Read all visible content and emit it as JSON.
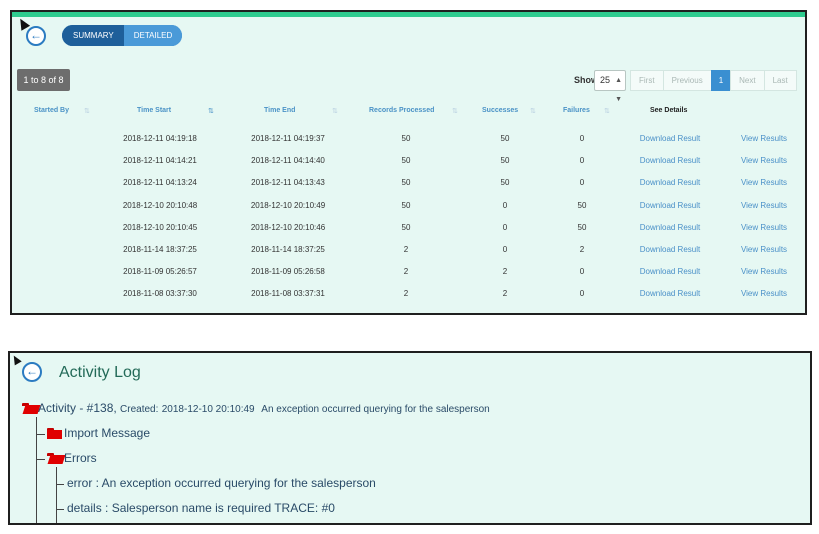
{
  "summary_panel": {
    "toggle": {
      "summary": "SUMMARY",
      "detailed": "DETAILED"
    },
    "record_count": "1 to 8 of 8",
    "show_label": "Show",
    "page_size": "25",
    "pager": {
      "first": "First",
      "previous": "Previous",
      "current": "1",
      "next": "Next",
      "last": "Last"
    },
    "columns": {
      "started_by": "Started By",
      "time_start": "Time Start",
      "time_end": "Time End",
      "records_processed": "Records Processed",
      "successes": "Successes",
      "failures": "Failures",
      "see_details": "See Details"
    },
    "rows": [
      {
        "start": "2018-12-11 04:19:18",
        "end": "2018-12-11 04:19:37",
        "records": "50",
        "successes": "50",
        "failures": "0",
        "download": "Download Result",
        "view": "View Results"
      },
      {
        "start": "2018-12-11 04:14:21",
        "end": "2018-12-11 04:14:40",
        "records": "50",
        "successes": "50",
        "failures": "0",
        "download": "Download Result",
        "view": "View Results"
      },
      {
        "start": "2018-12-11 04:13:24",
        "end": "2018-12-11 04:13:43",
        "records": "50",
        "successes": "50",
        "failures": "0",
        "download": "Download Result",
        "view": "View Results"
      },
      {
        "start": "2018-12-10 20:10:48",
        "end": "2018-12-10 20:10:49",
        "records": "50",
        "successes": "0",
        "failures": "50",
        "download": "Download Result",
        "view": "View Results"
      },
      {
        "start": "2018-12-10 20:10:45",
        "end": "2018-12-10 20:10:46",
        "records": "50",
        "successes": "0",
        "failures": "50",
        "download": "Download Result",
        "view": "View Results"
      },
      {
        "start": "2018-11-14 18:37:25",
        "end": "2018-11-14 18:37:25",
        "records": "2",
        "successes": "0",
        "failures": "2",
        "download": "Download Result",
        "view": "View Results"
      },
      {
        "start": "2018-11-09 05:26:57",
        "end": "2018-11-09 05:26:58",
        "records": "2",
        "successes": "2",
        "failures": "0",
        "download": "Download Result",
        "view": "View Results"
      },
      {
        "start": "2018-11-08 03:37:30",
        "end": "2018-11-08 03:37:31",
        "records": "2",
        "successes": "2",
        "failures": "0",
        "download": "Download Result",
        "view": "View Results"
      }
    ]
  },
  "activity_panel": {
    "title": "Activity Log",
    "root": {
      "label": "Activity - #138,",
      "created_label": "Created:",
      "created_value": "2018-12-10 20:10:49",
      "message": "An exception occurred querying for the salesperson"
    },
    "import_message": "Import Message",
    "errors": "Errors",
    "error_line": "error : An exception occurred querying for the salesperson",
    "details_line": "details : Salesperson name is required TRACE: #0"
  },
  "colors": {
    "accent_green": "#2ecc8f",
    "panel_bg": "#e6f8f3",
    "primary_blue": "#2b7bc1",
    "folder_red": "#e00000"
  },
  "icons": [
    "back-arrow-icon",
    "cursor-icon",
    "sort-icon",
    "folder-open-icon",
    "folder-icon"
  ]
}
